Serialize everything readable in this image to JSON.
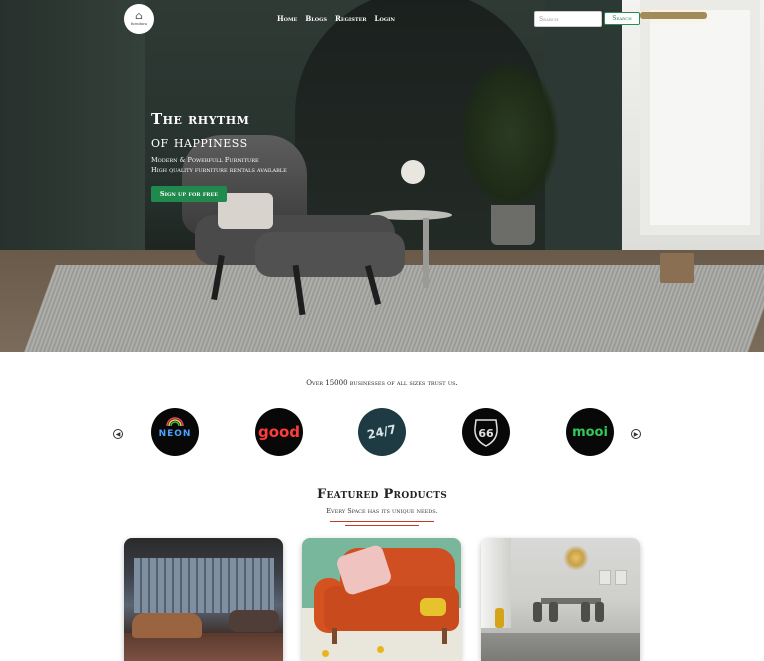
{
  "nav": {
    "logo_text": "furnitura",
    "links": [
      "Home",
      "Blogs",
      "Register",
      "Login"
    ]
  },
  "search": {
    "placeholder": "Search",
    "button_label": "Search"
  },
  "hero": {
    "title_line1": "The rhythm",
    "title_line2": "of happiness",
    "subtitle_line1": "Modern & Powerfull Furniture",
    "subtitle_line2": "High quality furniture rentals available",
    "cta_label": "Sign up for free"
  },
  "trust": {
    "text": "Over 15000 businesses of all sizes trust us.",
    "brands": [
      {
        "icon": "neon-logo",
        "label": "NEON"
      },
      {
        "icon": "good-logo",
        "label": "good"
      },
      {
        "icon": "sign-logo",
        "label": "24/7"
      },
      {
        "icon": "route66-logo",
        "label": "66"
      },
      {
        "icon": "mooi-logo",
        "label": "mooi"
      }
    ]
  },
  "featured": {
    "title": "Featured Products",
    "subtitle": "Every Space has its unique needs."
  },
  "colors": {
    "accent_green": "#1f8a4c",
    "divider_red": "#c0392b"
  }
}
